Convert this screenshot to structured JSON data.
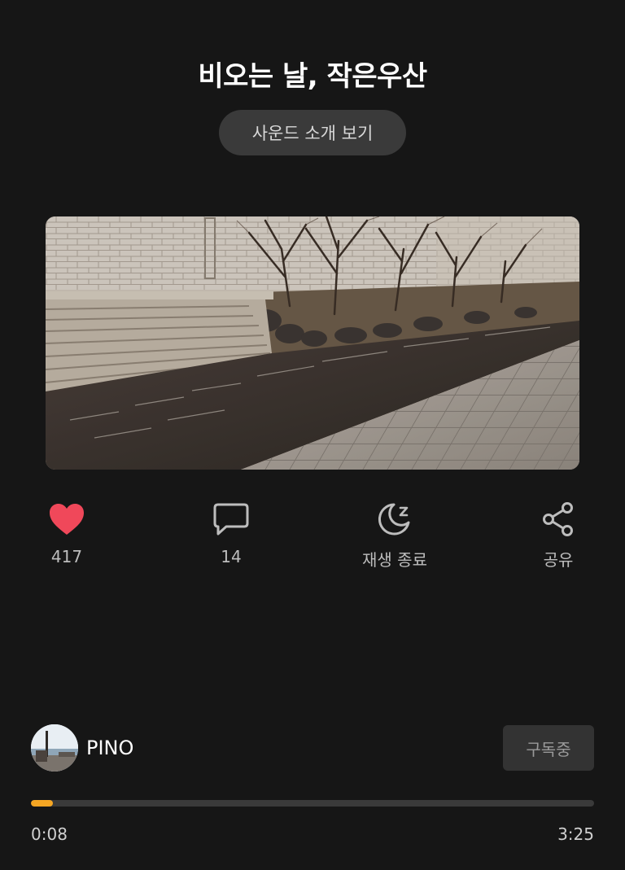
{
  "track": {
    "title": "비오는 날, 작은우산",
    "intro_button_label": "사운드 소개 보기"
  },
  "actions": {
    "like": {
      "icon": "heart-icon",
      "count": "417",
      "color": "#f0485a"
    },
    "comment": {
      "icon": "comment-icon",
      "count": "14"
    },
    "sleep_timer": {
      "icon": "moon-zzz-icon",
      "label": "재생 종료"
    },
    "share": {
      "icon": "share-icon",
      "label": "공유"
    }
  },
  "creator": {
    "name": "PINO",
    "subscribe_label": "구독중"
  },
  "player": {
    "current_time": "0:08",
    "total_time": "3:25",
    "progress_fraction": 0.039,
    "progress_color": "#f5a623"
  }
}
